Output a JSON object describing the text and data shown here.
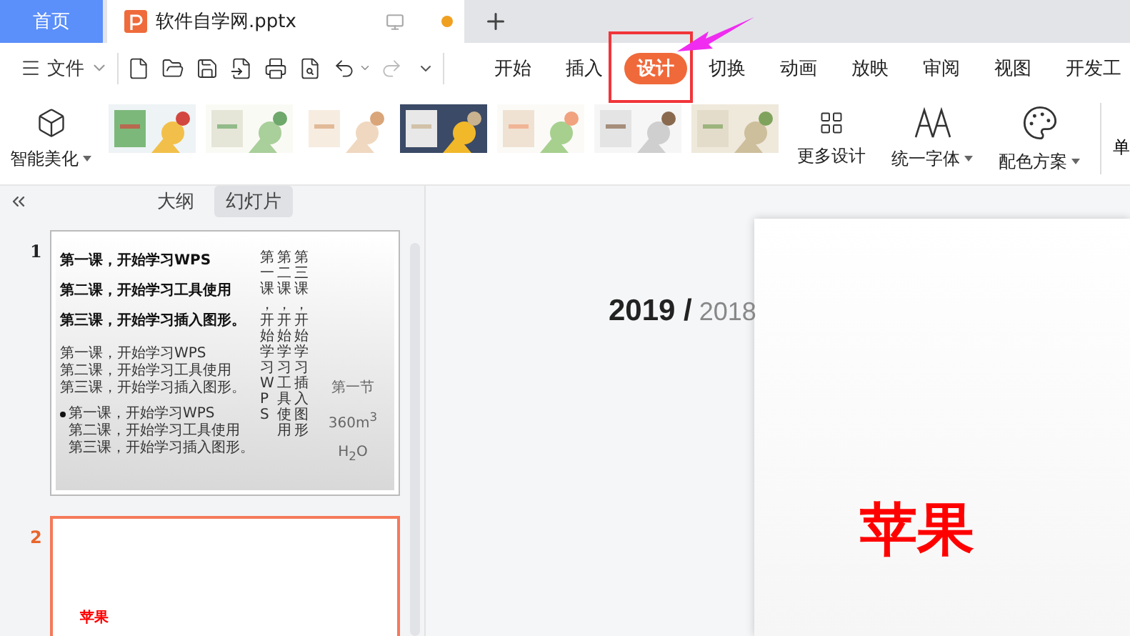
{
  "tabs": [
    {
      "label": "首页",
      "kind": "home",
      "selected": false
    },
    {
      "label": "软件自学网.pptx",
      "kind": "document",
      "selected": true,
      "unsaved": true
    }
  ],
  "menu": {
    "file": "文件",
    "items": [
      {
        "label": "开始",
        "selected": false
      },
      {
        "label": "插入",
        "selected": false
      },
      {
        "label": "设计",
        "selected": true
      },
      {
        "label": "切换",
        "selected": false
      },
      {
        "label": "动画",
        "selected": false
      },
      {
        "label": "放映",
        "selected": false
      },
      {
        "label": "审阅",
        "selected": false
      },
      {
        "label": "视图",
        "selected": false
      },
      {
        "label": "开发工",
        "selected": false
      }
    ]
  },
  "ribbon": {
    "smart": "智能美化",
    "tools": [
      {
        "label": "更多设计",
        "kind": "grid",
        "dropdown": false
      },
      {
        "label": "统一字体",
        "kind": "font",
        "dropdown": true
      },
      {
        "label": "配色方案",
        "kind": "palette",
        "dropdown": true
      }
    ],
    "cut_label": "单"
  },
  "panel": {
    "tabs": [
      {
        "label": "大纲",
        "selected": false
      },
      {
        "label": "幻灯片",
        "selected": true
      }
    ],
    "slides": [
      {
        "number": "1",
        "selected": false,
        "kind": "lessons",
        "headings": [
          "第一课，开始学习WPS",
          "第二课，开始学习工具使用",
          "第三课，开始学习插入图形。"
        ],
        "list_a": [
          "第一课，开始学习WPS",
          "第二课，开始学习工具使用",
          "第三课，开始学习插入图形。"
        ],
        "list_b": [
          "第一课，开始学习WPS",
          "第二课，开始学习工具使用",
          "第三课，开始学习插入图形。"
        ],
        "vertical": [
          "第一课，开始学习WPS",
          "第二课，开始学习工具使用",
          "第三课，开始学习插入图形"
        ],
        "side": [
          "第一节",
          "360m$^{3}$",
          "H$_{2}$O"
        ]
      },
      {
        "number": "2",
        "selected": true,
        "kind": "title",
        "title": "苹果"
      }
    ]
  },
  "canvas": {
    "year": "2019 /",
    "prev_year": "2018",
    "title": "苹果"
  }
}
